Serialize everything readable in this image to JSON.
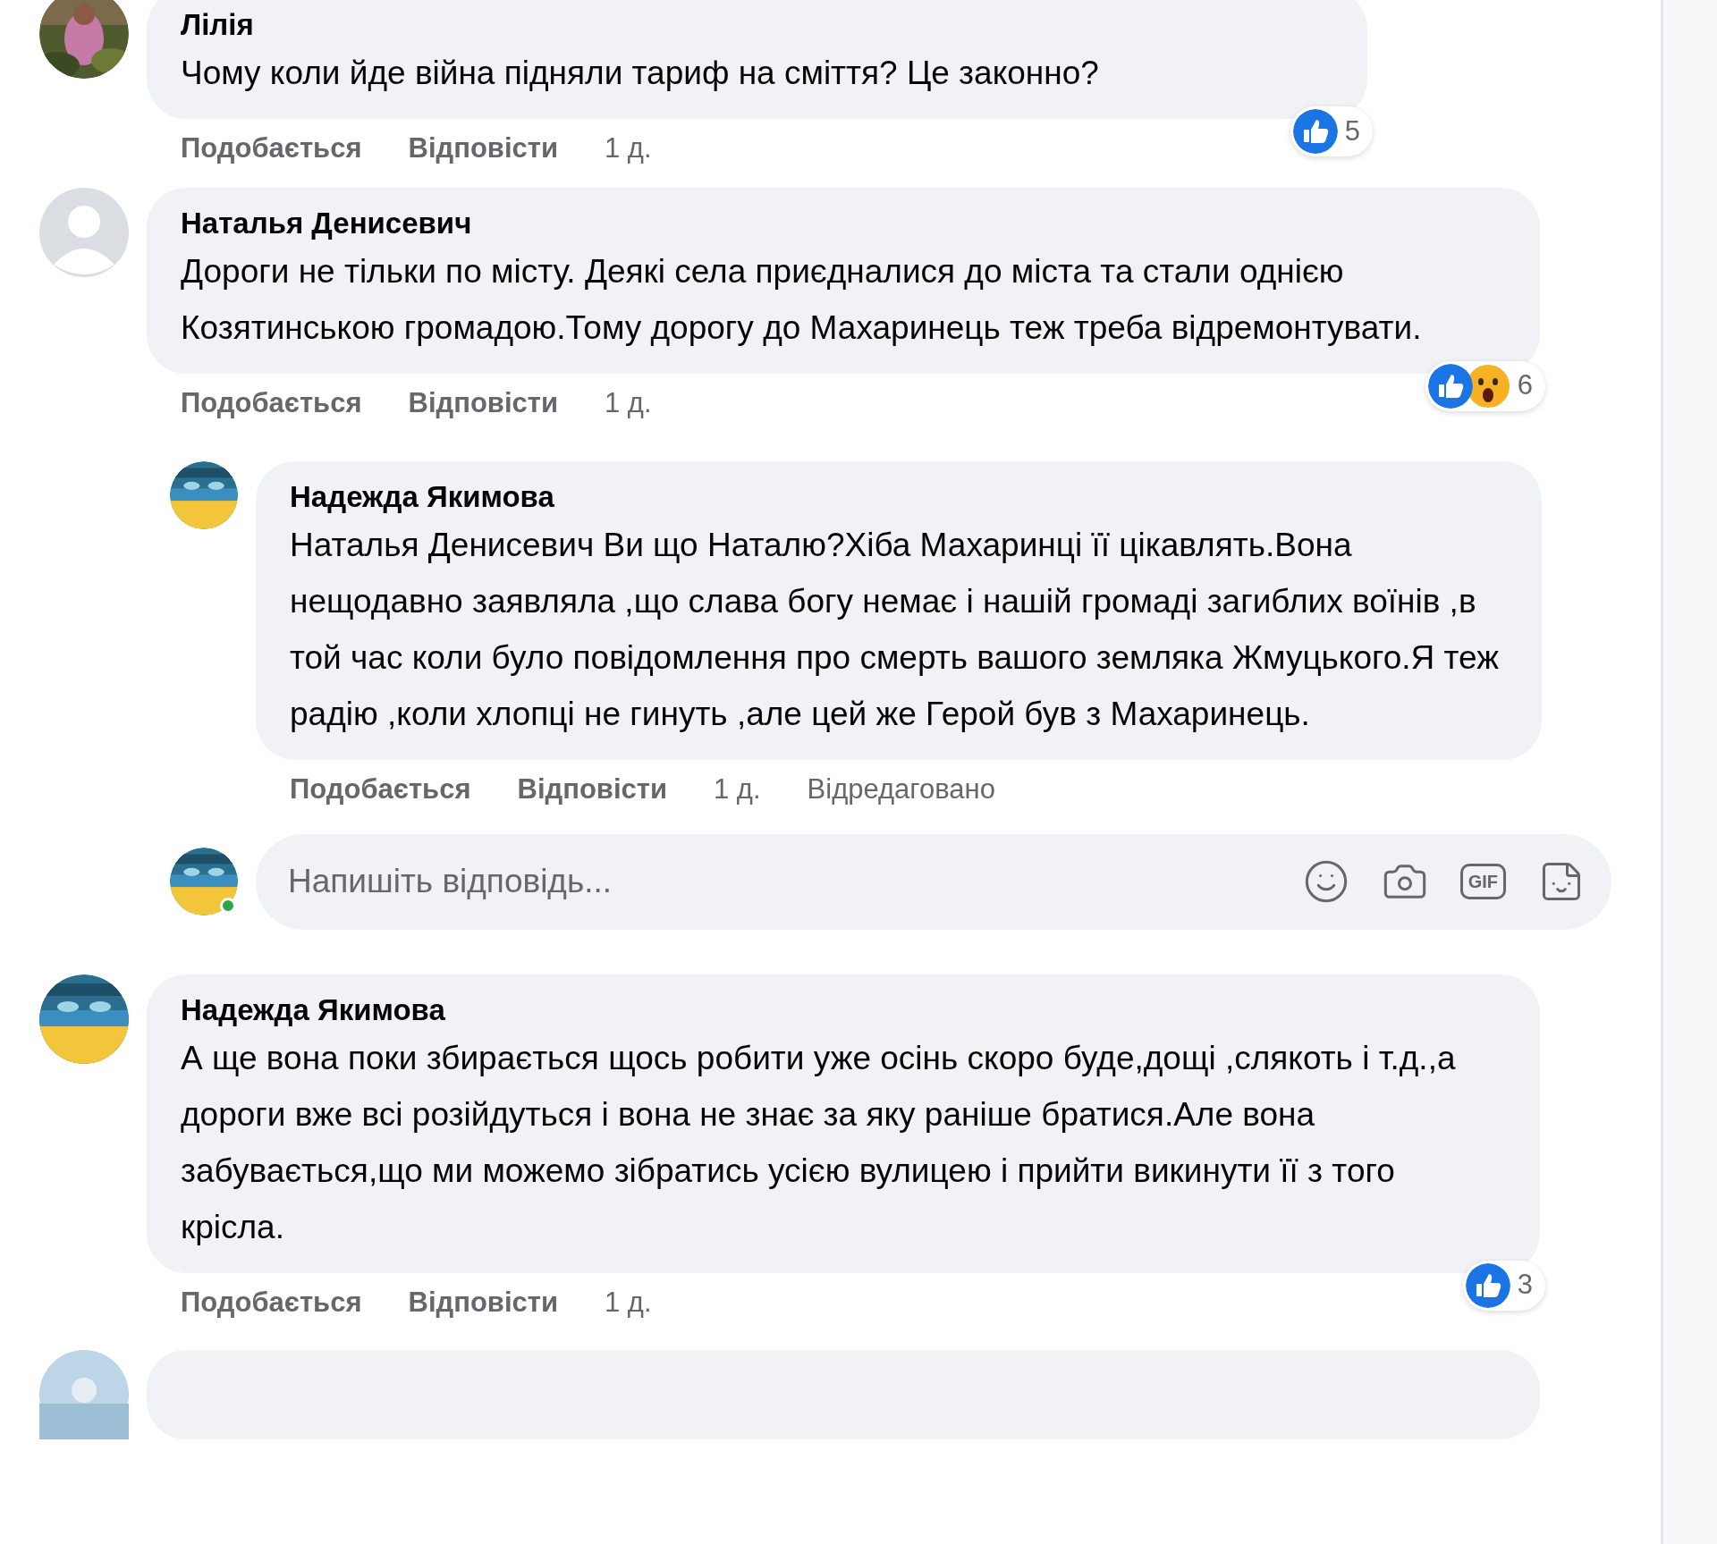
{
  "comments": [
    {
      "author": "Лілія",
      "text": "Чому коли йде війна підняли тариф на сміття? Це законно?",
      "reactions": {
        "types": [
          {
            "kind": "like"
          }
        ],
        "count": "5"
      },
      "actions": {
        "like": "Подобається",
        "reply": "Відповісти",
        "time": "1 д."
      }
    },
    {
      "author": "Наталья Денисевич",
      "avatar": {
        "kind": "default"
      },
      "text": "Дороги не тільки по місту. Деякі села приєдналися до міста та стали однією Козятинською громадою.Тому дорогу до Махаринець теж треба відремонтувати.",
      "reactions": {
        "types": [
          {
            "kind": "like"
          },
          {
            "kind": "wow"
          }
        ],
        "count": "6"
      },
      "actions": {
        "like": "Подобається",
        "reply": "Відповісти",
        "time": "1 д."
      },
      "replies": [
        {
          "author": "Надежда Якимова",
          "text": "Наталья Денисевич Ви що Наталю?Хіба Махаринці її цікавлять.Вона нещодавно заявляла ,що слава богу немає і нашій громаді загиблих воїнів ,в той час коли було повідомлення про смерть вашого земляка Жмуцького.Я теж радію ,коли хлопці не гинуть ,але цей же Герой був з Махаринець.",
          "actions": {
            "like": "Подобається",
            "reply": "Відповісти",
            "time": "1 д.",
            "edited": "Відредаговано"
          }
        }
      ],
      "reply_box": {
        "placeholder": "Напишіть відповідь...",
        "online": true,
        "gif_label": "GIF"
      }
    },
    {
      "author": "Надежда Якимова",
      "text": "А ще вона поки збирається щось робити уже осінь скоро буде,дощі ,слякоть і т.д.,а дороги вже всі розійдуться і вона не знає за яку раніше братися.Але вона забувається,що ми можемо зібратись усією вулицею і прийти викинути її з того крісла.",
      "reactions": {
        "types": [
          {
            "kind": "like"
          }
        ],
        "count": "3"
      },
      "actions": {
        "like": "Подобається",
        "reply": "Відповісти",
        "time": "1 д."
      }
    }
  ]
}
